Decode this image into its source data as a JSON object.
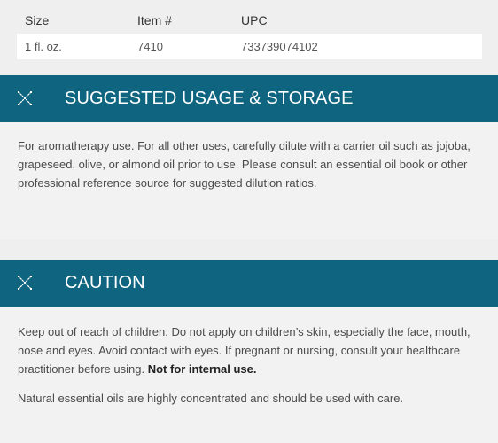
{
  "product_table": {
    "headers": [
      "Size",
      "Item #",
      "UPC"
    ],
    "rows": [
      [
        "1 fl. oz.",
        "7410",
        "733739074102"
      ]
    ]
  },
  "usage_section": {
    "icon": "expand-icon",
    "title": "SUGGESTED USAGE & STORAGE",
    "text": "For aromatherapy use. For all other uses, carefully dilute with a carrier oil such as jojoba, grapeseed, olive, or almond oil prior to use. Please consult an essential oil book or other professional reference source for suggested dilution ratios."
  },
  "caution_section": {
    "icon": "expand-icon",
    "title": "CAUTION",
    "text_main": "Keep out of reach of children. Do not apply on children’s skin, especially the face, mouth, nose and eyes. Avoid contact with eyes. If pregnant or nursing, consult your healthcare practitioner before using.",
    "text_bold": "Not for internal use.",
    "text_second": "Natural essential oils are highly concentrated and should be used with care."
  },
  "colors": {
    "header_bg": "#0f6580",
    "header_text": "#ffffff",
    "body_bg": "#f2f2f2"
  }
}
